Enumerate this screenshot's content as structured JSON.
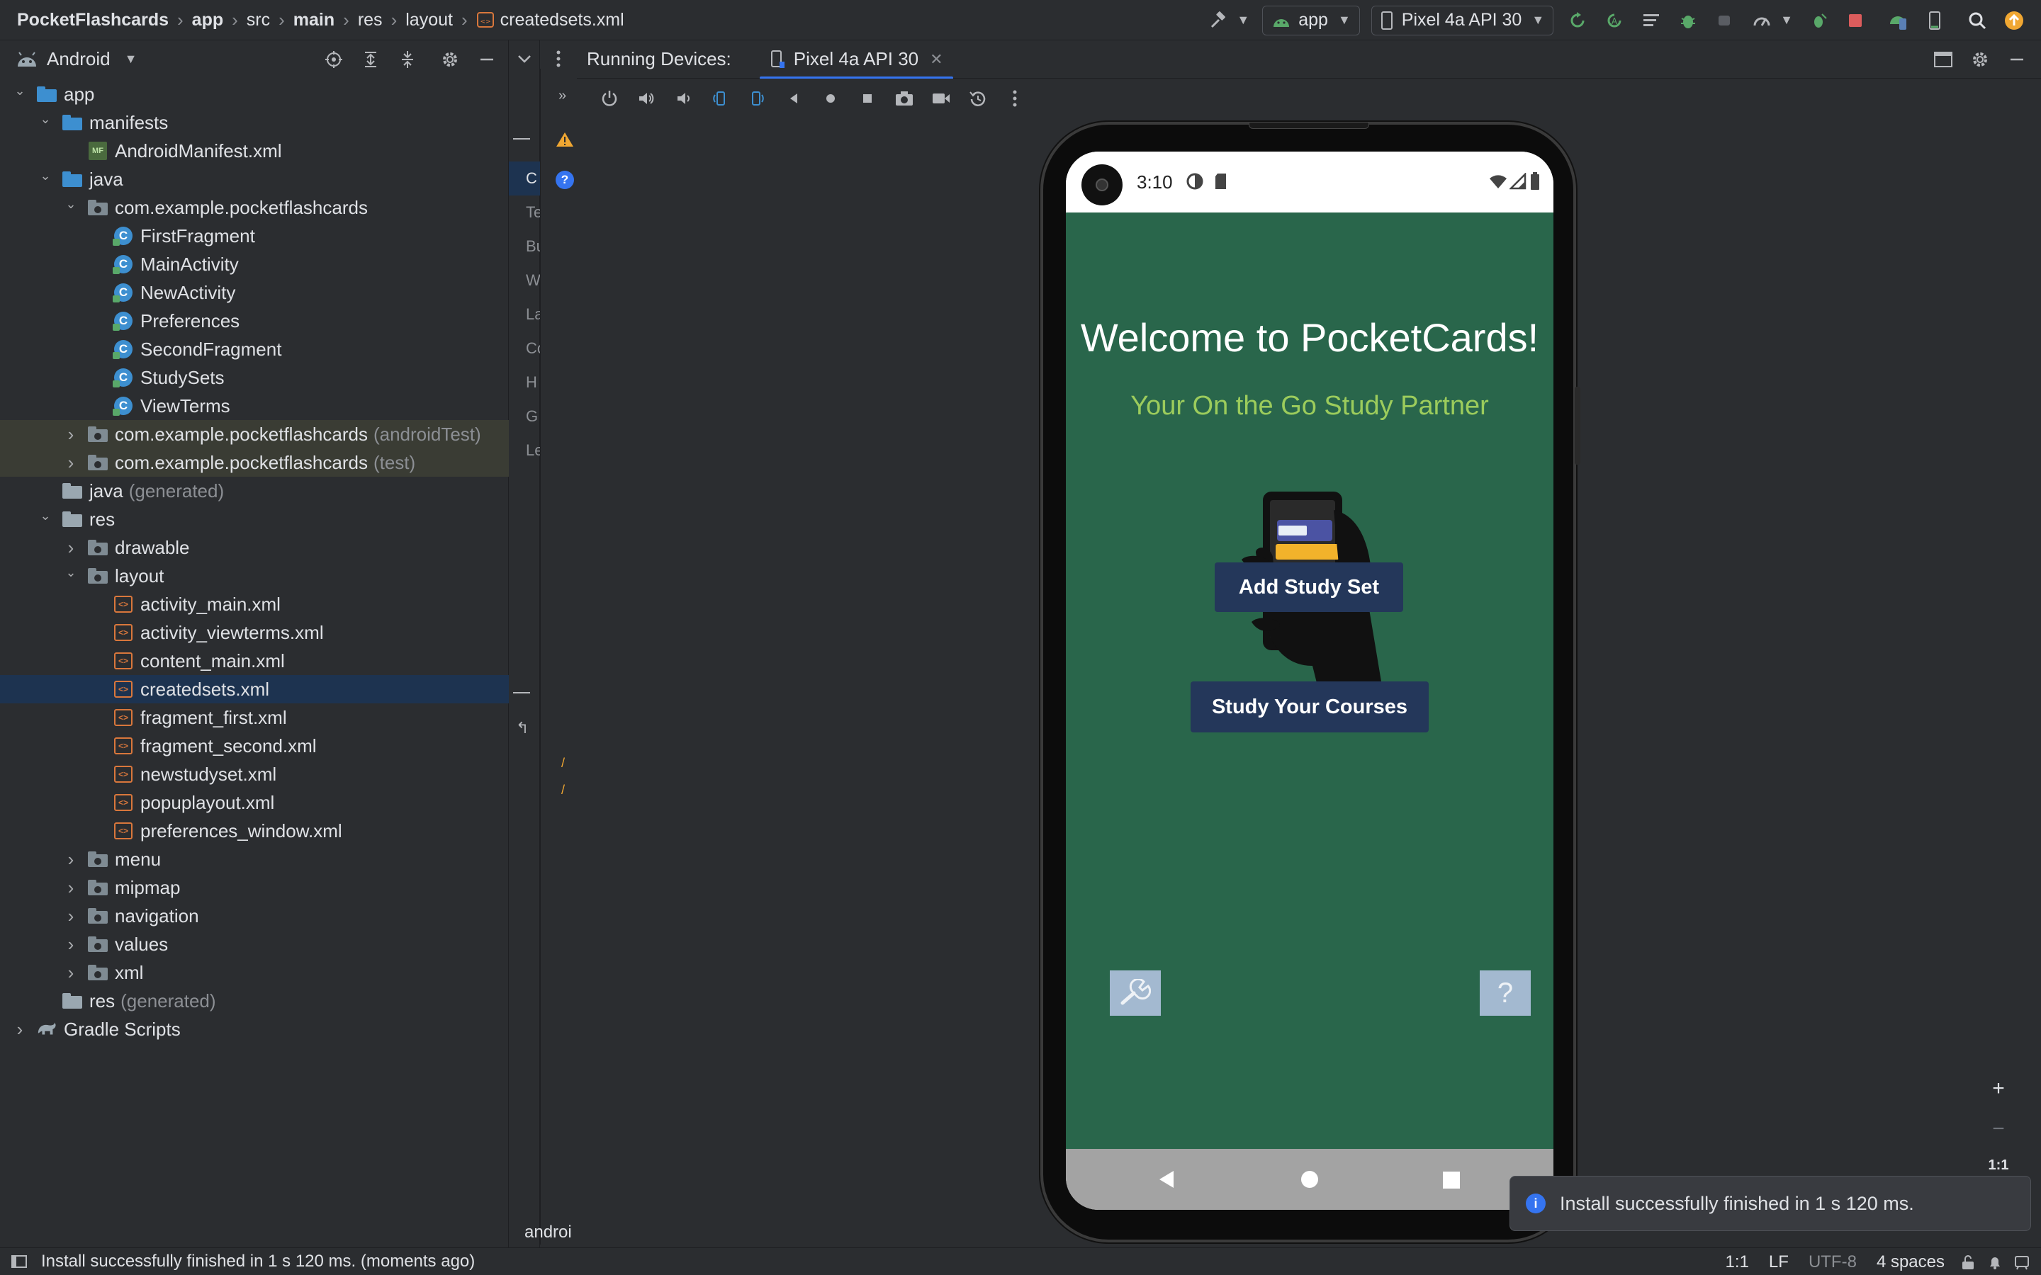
{
  "breadcrumbs": [
    {
      "label": "PocketFlashcards",
      "bold": true
    },
    {
      "label": "app",
      "bold": true
    },
    {
      "label": "src",
      "bold": false
    },
    {
      "label": "main",
      "bold": true
    },
    {
      "label": "res",
      "bold": false
    },
    {
      "label": "layout",
      "bold": false
    },
    {
      "label": "createdsets.xml",
      "bold": false
    }
  ],
  "toolbar": {
    "run_config": "app",
    "device": "Pixel 4a API 30"
  },
  "project_panel": {
    "view_mode": "Android",
    "tree": [
      {
        "label": "app",
        "depth": 0,
        "icon": "module-folder",
        "expanded": true
      },
      {
        "label": "manifests",
        "depth": 1,
        "icon": "folder-blue",
        "expanded": true
      },
      {
        "label": "AndroidManifest.xml",
        "depth": 2,
        "icon": "manifest"
      },
      {
        "label": "java",
        "depth": 1,
        "icon": "folder-blue",
        "expanded": true
      },
      {
        "label": "com.example.pocketflashcards",
        "depth": 2,
        "icon": "package",
        "expanded": true
      },
      {
        "label": "FirstFragment",
        "depth": 3,
        "icon": "class"
      },
      {
        "label": "MainActivity",
        "depth": 3,
        "icon": "class"
      },
      {
        "label": "NewActivity",
        "depth": 3,
        "icon": "class"
      },
      {
        "label": "Preferences",
        "depth": 3,
        "icon": "class"
      },
      {
        "label": "SecondFragment",
        "depth": 3,
        "icon": "class"
      },
      {
        "label": "StudySets",
        "depth": 3,
        "icon": "class"
      },
      {
        "label": "ViewTerms",
        "depth": 3,
        "icon": "class"
      },
      {
        "label": "com.example.pocketflashcards",
        "suffix": "(androidTest)",
        "depth": 2,
        "icon": "package",
        "expanded": false,
        "highlight": true
      },
      {
        "label": "com.example.pocketflashcards",
        "suffix": "(test)",
        "depth": 2,
        "icon": "package",
        "expanded": false,
        "highlight": true
      },
      {
        "label": "java",
        "suffix": "(generated)",
        "depth": 1,
        "icon": "folder-gen"
      },
      {
        "label": "res",
        "depth": 1,
        "icon": "folder-res",
        "expanded": true
      },
      {
        "label": "drawable",
        "depth": 2,
        "icon": "package",
        "expanded": false
      },
      {
        "label": "layout",
        "depth": 2,
        "icon": "package",
        "expanded": true
      },
      {
        "label": "activity_main.xml",
        "depth": 3,
        "icon": "xml"
      },
      {
        "label": "activity_viewterms.xml",
        "depth": 3,
        "icon": "xml"
      },
      {
        "label": "content_main.xml",
        "depth": 3,
        "icon": "xml"
      },
      {
        "label": "createdsets.xml",
        "depth": 3,
        "icon": "xml",
        "selected": true
      },
      {
        "label": "fragment_first.xml",
        "depth": 3,
        "icon": "xml"
      },
      {
        "label": "fragment_second.xml",
        "depth": 3,
        "icon": "xml"
      },
      {
        "label": "newstudyset.xml",
        "depth": 3,
        "icon": "xml"
      },
      {
        "label": "popuplayout.xml",
        "depth": 3,
        "icon": "xml"
      },
      {
        "label": "preferences_window.xml",
        "depth": 3,
        "icon": "xml"
      },
      {
        "label": "menu",
        "depth": 2,
        "icon": "package",
        "expanded": false
      },
      {
        "label": "mipmap",
        "depth": 2,
        "icon": "package",
        "expanded": false
      },
      {
        "label": "navigation",
        "depth": 2,
        "icon": "package",
        "expanded": false
      },
      {
        "label": "values",
        "depth": 2,
        "icon": "package",
        "expanded": false
      },
      {
        "label": "xml",
        "depth": 2,
        "icon": "package",
        "expanded": false
      },
      {
        "label": "res",
        "suffix": "(generated)",
        "depth": 1,
        "icon": "folder-gen"
      },
      {
        "label": "Gradle Scripts",
        "depth": 0,
        "icon": "gradle",
        "expanded": false
      }
    ]
  },
  "gutter_labels": [
    "C",
    "Te",
    "Bu",
    "W",
    "La",
    "Co",
    "H",
    "G",
    "Le"
  ],
  "running_devices": {
    "title": "Running Devices:",
    "tab": "Pixel 4a API 30"
  },
  "phone": {
    "time": "3:10",
    "welcome": "Welcome to PocketCards!",
    "tagline": "Your On the Go Study Partner",
    "add_button": "Add Study Set",
    "study_button": "Study Your Courses",
    "help_glyph": "?"
  },
  "zoom": {
    "reset_label": "1:1"
  },
  "notification": "Install successfully finished in 1 s 120 ms.",
  "editor_tab": "androi",
  "status": {
    "message": "Install successfully finished in 1 s 120 ms. (moments ago)",
    "position": "1:1",
    "line_sep": "LF",
    "encoding": "UTF-8",
    "indent": "4 spaces"
  },
  "colors": {
    "app_bg": "#29664b",
    "tagline": "#9ccc5c",
    "button": "#24375a",
    "accent": "#3574f0"
  }
}
